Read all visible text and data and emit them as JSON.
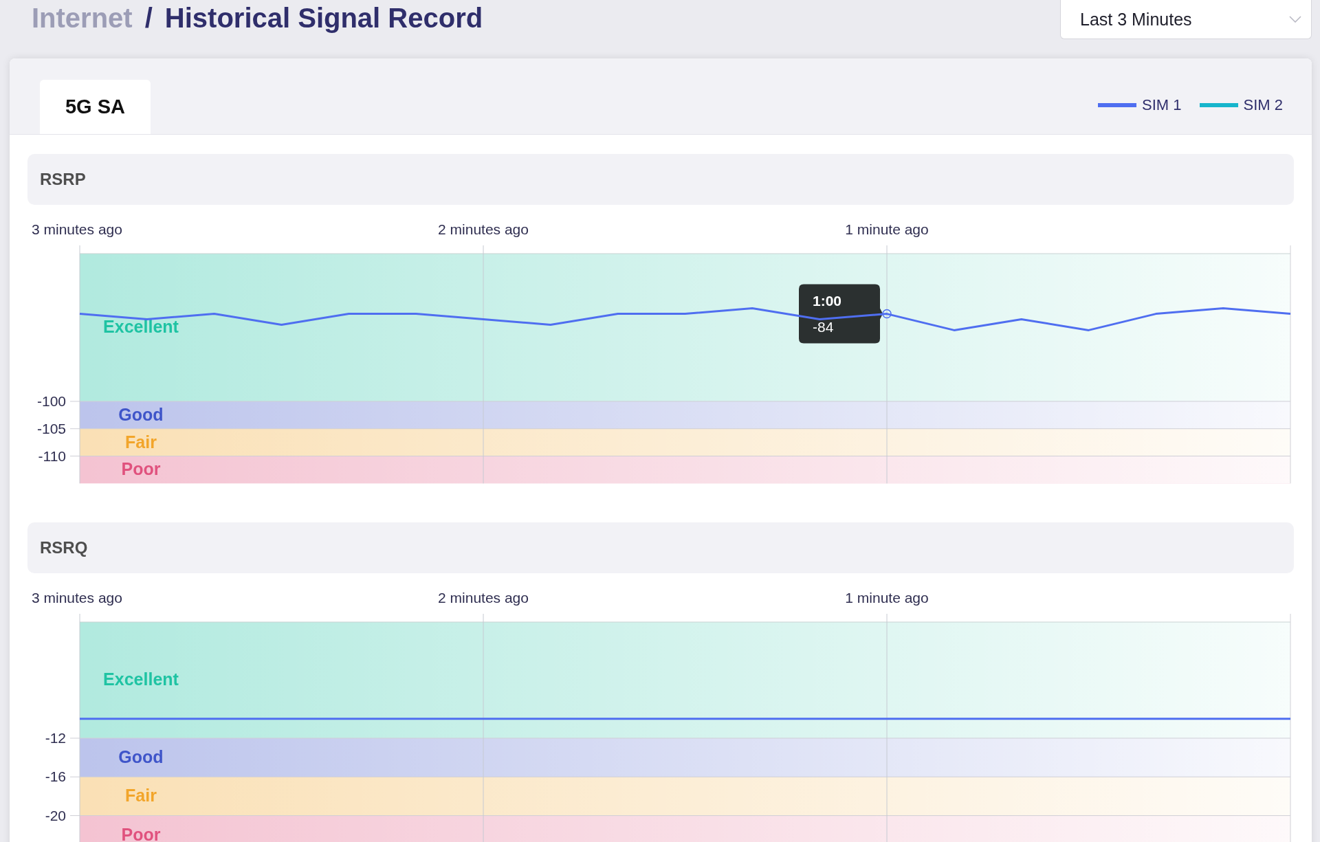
{
  "breadcrumb": {
    "parent": "Internet",
    "separator": "/",
    "current": "Historical Signal Record"
  },
  "range_select": {
    "value": "Last 3 Minutes"
  },
  "tabs": [
    {
      "label": "5G SA",
      "selected": true
    }
  ],
  "legend": [
    {
      "name": "SIM 1",
      "color": "#4f6ef0"
    },
    {
      "name": "SIM 2",
      "color": "#17b5cc"
    }
  ],
  "sections": [
    {
      "title": "RSRP",
      "tooltip_time": "1:00",
      "chart_data": {
        "type": "line",
        "grid": true,
        "categories": [
          "3 minutes ago",
          null,
          null,
          null,
          null,
          null,
          "2 minutes ago",
          null,
          null,
          null,
          null,
          null,
          "1 minute ago",
          null,
          null,
          null,
          null,
          null,
          null
        ],
        "ylim": [
          -115,
          -73
        ],
        "yticks": [
          -100,
          -105,
          -110
        ],
        "series": [
          {
            "color": "#4f6ef0",
            "values": [
              -84,
              -85,
              -84,
              -86,
              -84,
              -84,
              -85,
              -86,
              -84,
              -84,
              -83,
              -85,
              -84,
              -87,
              -85,
              -87,
              -84,
              -83,
              -84
            ]
          }
        ],
        "bands": [
          {
            "label": "Excellent",
            "color": "#1fc3a3",
            "axis": "y",
            "from": -100,
            "to": -73
          },
          {
            "label": "Good",
            "color": "#3f55c9",
            "axis": "y",
            "from": -105,
            "to": -100
          },
          {
            "label": "Fair",
            "color": "#f2a52a",
            "axis": "y",
            "from": -110,
            "to": -105
          },
          {
            "label": "Poor",
            "color": "#e0527e",
            "axis": "y",
            "from": -115,
            "to": -110
          }
        ],
        "annotations": [
          "-84"
        ]
      }
    },
    {
      "title": "RSRQ",
      "chart_data": {
        "type": "line",
        "grid": true,
        "categories": [
          "3 minutes ago",
          null,
          null,
          null,
          null,
          null,
          "2 minutes ago",
          null,
          null,
          null,
          null,
          null,
          "1 minute ago",
          null,
          null,
          null,
          null,
          null,
          null
        ],
        "ylim": [
          -24,
          0
        ],
        "yticks": [
          -12,
          -16,
          -20
        ],
        "series": [
          {
            "color": "#4f6ef0",
            "values": [
              -10,
              -10,
              -10,
              -10,
              -10,
              -10,
              -10,
              -10,
              -10,
              -10,
              -10,
              -10,
              -10,
              -10,
              -10,
              -10,
              -10,
              -10,
              -10
            ]
          }
        ],
        "bands": [
          {
            "label": "Excellent",
            "color": "#1fc3a3",
            "axis": "y",
            "from": -12,
            "to": 0
          },
          {
            "label": "Good",
            "color": "#3f55c9",
            "axis": "y",
            "from": -16,
            "to": -12
          },
          {
            "label": "Fair",
            "color": "#f2a52a",
            "axis": "y",
            "from": -20,
            "to": -16
          },
          {
            "label": "Poor",
            "color": "#e0527e",
            "axis": "y",
            "from": -24,
            "to": -20
          }
        ]
      }
    }
  ]
}
